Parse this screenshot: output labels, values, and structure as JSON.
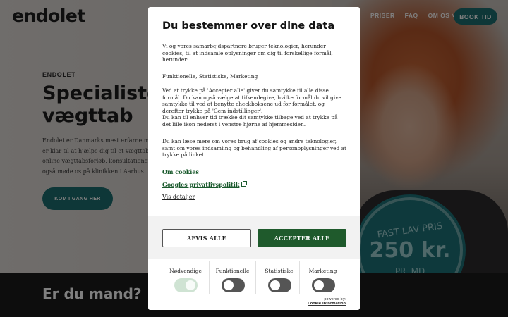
{
  "site": {
    "logo": "endolet",
    "nav": [
      "PRISER",
      "FAQ",
      "OM OS ˅"
    ],
    "book_button": "BOOK TID",
    "hero": {
      "eyebrow": "ENDOLET",
      "title_line1": "Specialister",
      "title_line2": "vægttab",
      "text_lines": [
        "Endolet er Danmarks mest erfarne medi",
        "er klar til at hjælpe dig til et vægttab. Vi",
        "online vægttabsforløb, konsultationer og",
        "også møde os på klinikken i Aarhus."
      ],
      "cta": "KOM I GANG HER"
    },
    "badge": {
      "line1": "FAST LAV PRIS",
      "line2": "250 kr.",
      "line3": "PR. MD"
    },
    "section_title": "Er du mand?"
  },
  "consent": {
    "title": "Du bestemmer over dine data",
    "intro": "Vi og vores samarbejdspartnere bruger teknologier, herunder cookies, til at indsamle oplysninger om dig til forskellige formål, herunder:",
    "purposes": "Funktionelle, Statistiske, Marketing",
    "accept_text": "Ved at trykke på 'Accepter alle' giver du samtykke til alle disse formål. Du kan også vælge at tilkendegive, hvilke formål du vil give samtykke til ved at benytte checkboksene ud for formålet, og derefter trykke på 'Gem indstillinger'.",
    "withdraw_text": "Du kan til enhver tid trække dit samtykke tilbage ved at trykke på det lille ikon nederst i venstre hjørne af hjemmesiden.",
    "more_text": "Du kan læse mere om vores brug af cookies og andre teknologier, samt om vores indsamling og behandling af personoplysninger ved at trykke på linket.",
    "link_cookies": "Om cookies",
    "link_google": "Googles privatlivspolitik",
    "link_details": "Vis detaljer",
    "reject_button": "AFVIS ALLE",
    "accept_button": "ACCEPTER ALLE",
    "toggles": [
      {
        "label": "Nødvendige",
        "on": true
      },
      {
        "label": "Funktionelle",
        "on": false
      },
      {
        "label": "Statistiske",
        "on": false
      },
      {
        "label": "Marketing",
        "on": false
      }
    ],
    "powered_by": "powered by:",
    "powered_name": "Cookie Information"
  },
  "colors": {
    "brand_teal": "#1d6e70",
    "accept_green": "#1f5a2c",
    "overlay": "rgba(0,0,0,0.5)"
  }
}
